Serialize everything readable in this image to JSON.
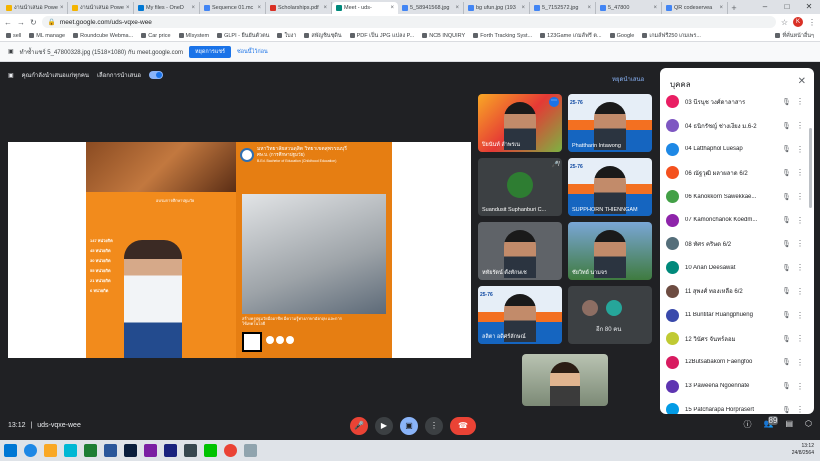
{
  "browser": {
    "tabs": [
      {
        "label": "งานนำเสนอ Powe",
        "color": "#f4b400"
      },
      {
        "label": "งานนำเสนอ Powe",
        "color": "#f4b400"
      },
      {
        "label": "My files - OneD",
        "color": "#0078d4"
      },
      {
        "label": "Sequence 01.mc",
        "color": "#4285f4"
      },
      {
        "label": "Scholarships.pdf",
        "color": "#d93025"
      },
      {
        "label": "Meet - uds-",
        "color": "#00897b"
      },
      {
        "label": "5_58941568.jpg",
        "color": "#4285f4"
      },
      {
        "label": "bg ufun.jpg (193",
        "color": "#4285f4"
      },
      {
        "label": "5_7152572.jpg",
        "color": "#4285f4"
      },
      {
        "label": "5_47800",
        "color": "#4285f4"
      },
      {
        "label": "QR codeservea",
        "color": "#4285f4"
      }
    ],
    "active_tab_index": 5,
    "new_tab": "+",
    "url": "meet.google.com/uds-vqxe-wee",
    "profile_initial": "K",
    "bookmarks": [
      "sell",
      "ML manage",
      "Roundcube Webma...",
      "Car price",
      "MIsystem",
      "GLPI - ยืนยันตัวตน",
      "ใบงา",
      "สพัญชินชุดิน",
      "PDF เป็น JPG แปลง P...",
      "NCB INQUIRY",
      "Forth Tracking Syst...",
      "123Game เกมส์ฟรี ต...",
      "Google",
      "เกมส์ฟรี250 เกมเพร...",
      "ที่คั่นหน้าอื่นๆ"
    ],
    "infobar_text": "ทำซ้ำแชร์ 5_47800328.jpg (1518×1080) กับ meet.google.com",
    "infobar_share": "หยุดการแชร์",
    "infobar_hide": "ซ่อนนี้ไว้ก่อน"
  },
  "meet": {
    "presenting_text": "คุณกำลังนำเสนอแก่ทุกคน",
    "captions_label": "เลือกการนำเสนอ",
    "stop_presenting": "หยุดนำเสนอ",
    "meeting_code": "uds-vqxe-wee",
    "time": "13:12",
    "participants_count": "89",
    "others_label": "อีก 80 คน",
    "tiles": [
      {
        "name": "ปิยนันท์ ลำพรเน"
      },
      {
        "name": "Phattharin Intawong"
      },
      {
        "name": "Suandusit Suphanburi C..."
      },
      {
        "name": "SUPPHORN THIENNGAM"
      },
      {
        "name": "หทัยรัตน์ ตั้งทักษเช"
      },
      {
        "name": "ชัยวิทย์ นามจร"
      },
      {
        "name": "ลลิตา อดิศร์ลักษณ์"
      }
    ],
    "slide": {
      "university": "มหาวิทยาลัยสวนดุสิต วิทยาเขตสุพรรณบุรี",
      "degree": "ศษ.บ. (การศึกษาปฐมวัย)",
      "degree_en": "B.Ed. Bachelor of Education (Childhood Education)",
      "sub": "อบรมการศึกษาปฐมวัย",
      "stats": [
        "147 หน่วยกิต",
        "45 หน่วยกิต",
        "30 หน่วยกิต",
        "55 หน่วยกิต",
        "21 หน่วยกิต",
        "6 หน่วยกิต"
      ],
      "footer": "สร้างครูปฐมวัยมืออาชีพ มีความรู้ทางภาษาอังกฤษ และการใช้เทคโนโลยี"
    }
  },
  "people": {
    "title": "บุคคล",
    "list": [
      {
        "name": "03 นีรนุช  วงศ์ดาลาสาร",
        "color": "#e91e63"
      },
      {
        "name": "04 ธนิกรัชญ์ ช่างเงียง ม.6-2",
        "color": "#7e57c2"
      },
      {
        "name": "04 Latthaphol Luesap",
        "color": "#1e88e5"
      },
      {
        "name": "06 ณัฐวุฒิ ผลาผลาด 6/2",
        "color": "#f4511e"
      },
      {
        "name": "06 Kanokkorn Sawekkae...",
        "color": "#43a047"
      },
      {
        "name": "07 Kamonchanok Koedm...",
        "color": "#8e24aa"
      },
      {
        "name": "08 ทัศร คริษด 6/2",
        "color": "#546e7a"
      },
      {
        "name": "10 Anan Deesawat",
        "color": "#00897b"
      },
      {
        "name": "11 สุพงศ์ ทองเหลือ 6/2",
        "color": "#6d4c41"
      },
      {
        "name": "11 Buntitar Ruangphueng",
        "color": "#3949ab"
      },
      {
        "name": "12 วินัศร จันทร์ลอม",
        "color": "#c0ca33"
      },
      {
        "name": "12Butsabakorn Faengfoo",
        "color": "#d81b60"
      },
      {
        "name": "13 Paweena Ngoennate",
        "color": "#5e35b1"
      },
      {
        "name": "15 Patcharapa Horprasert",
        "color": "#039be5"
      }
    ]
  },
  "taskbar": {
    "time": "13:12",
    "date": "24/8/2564"
  }
}
